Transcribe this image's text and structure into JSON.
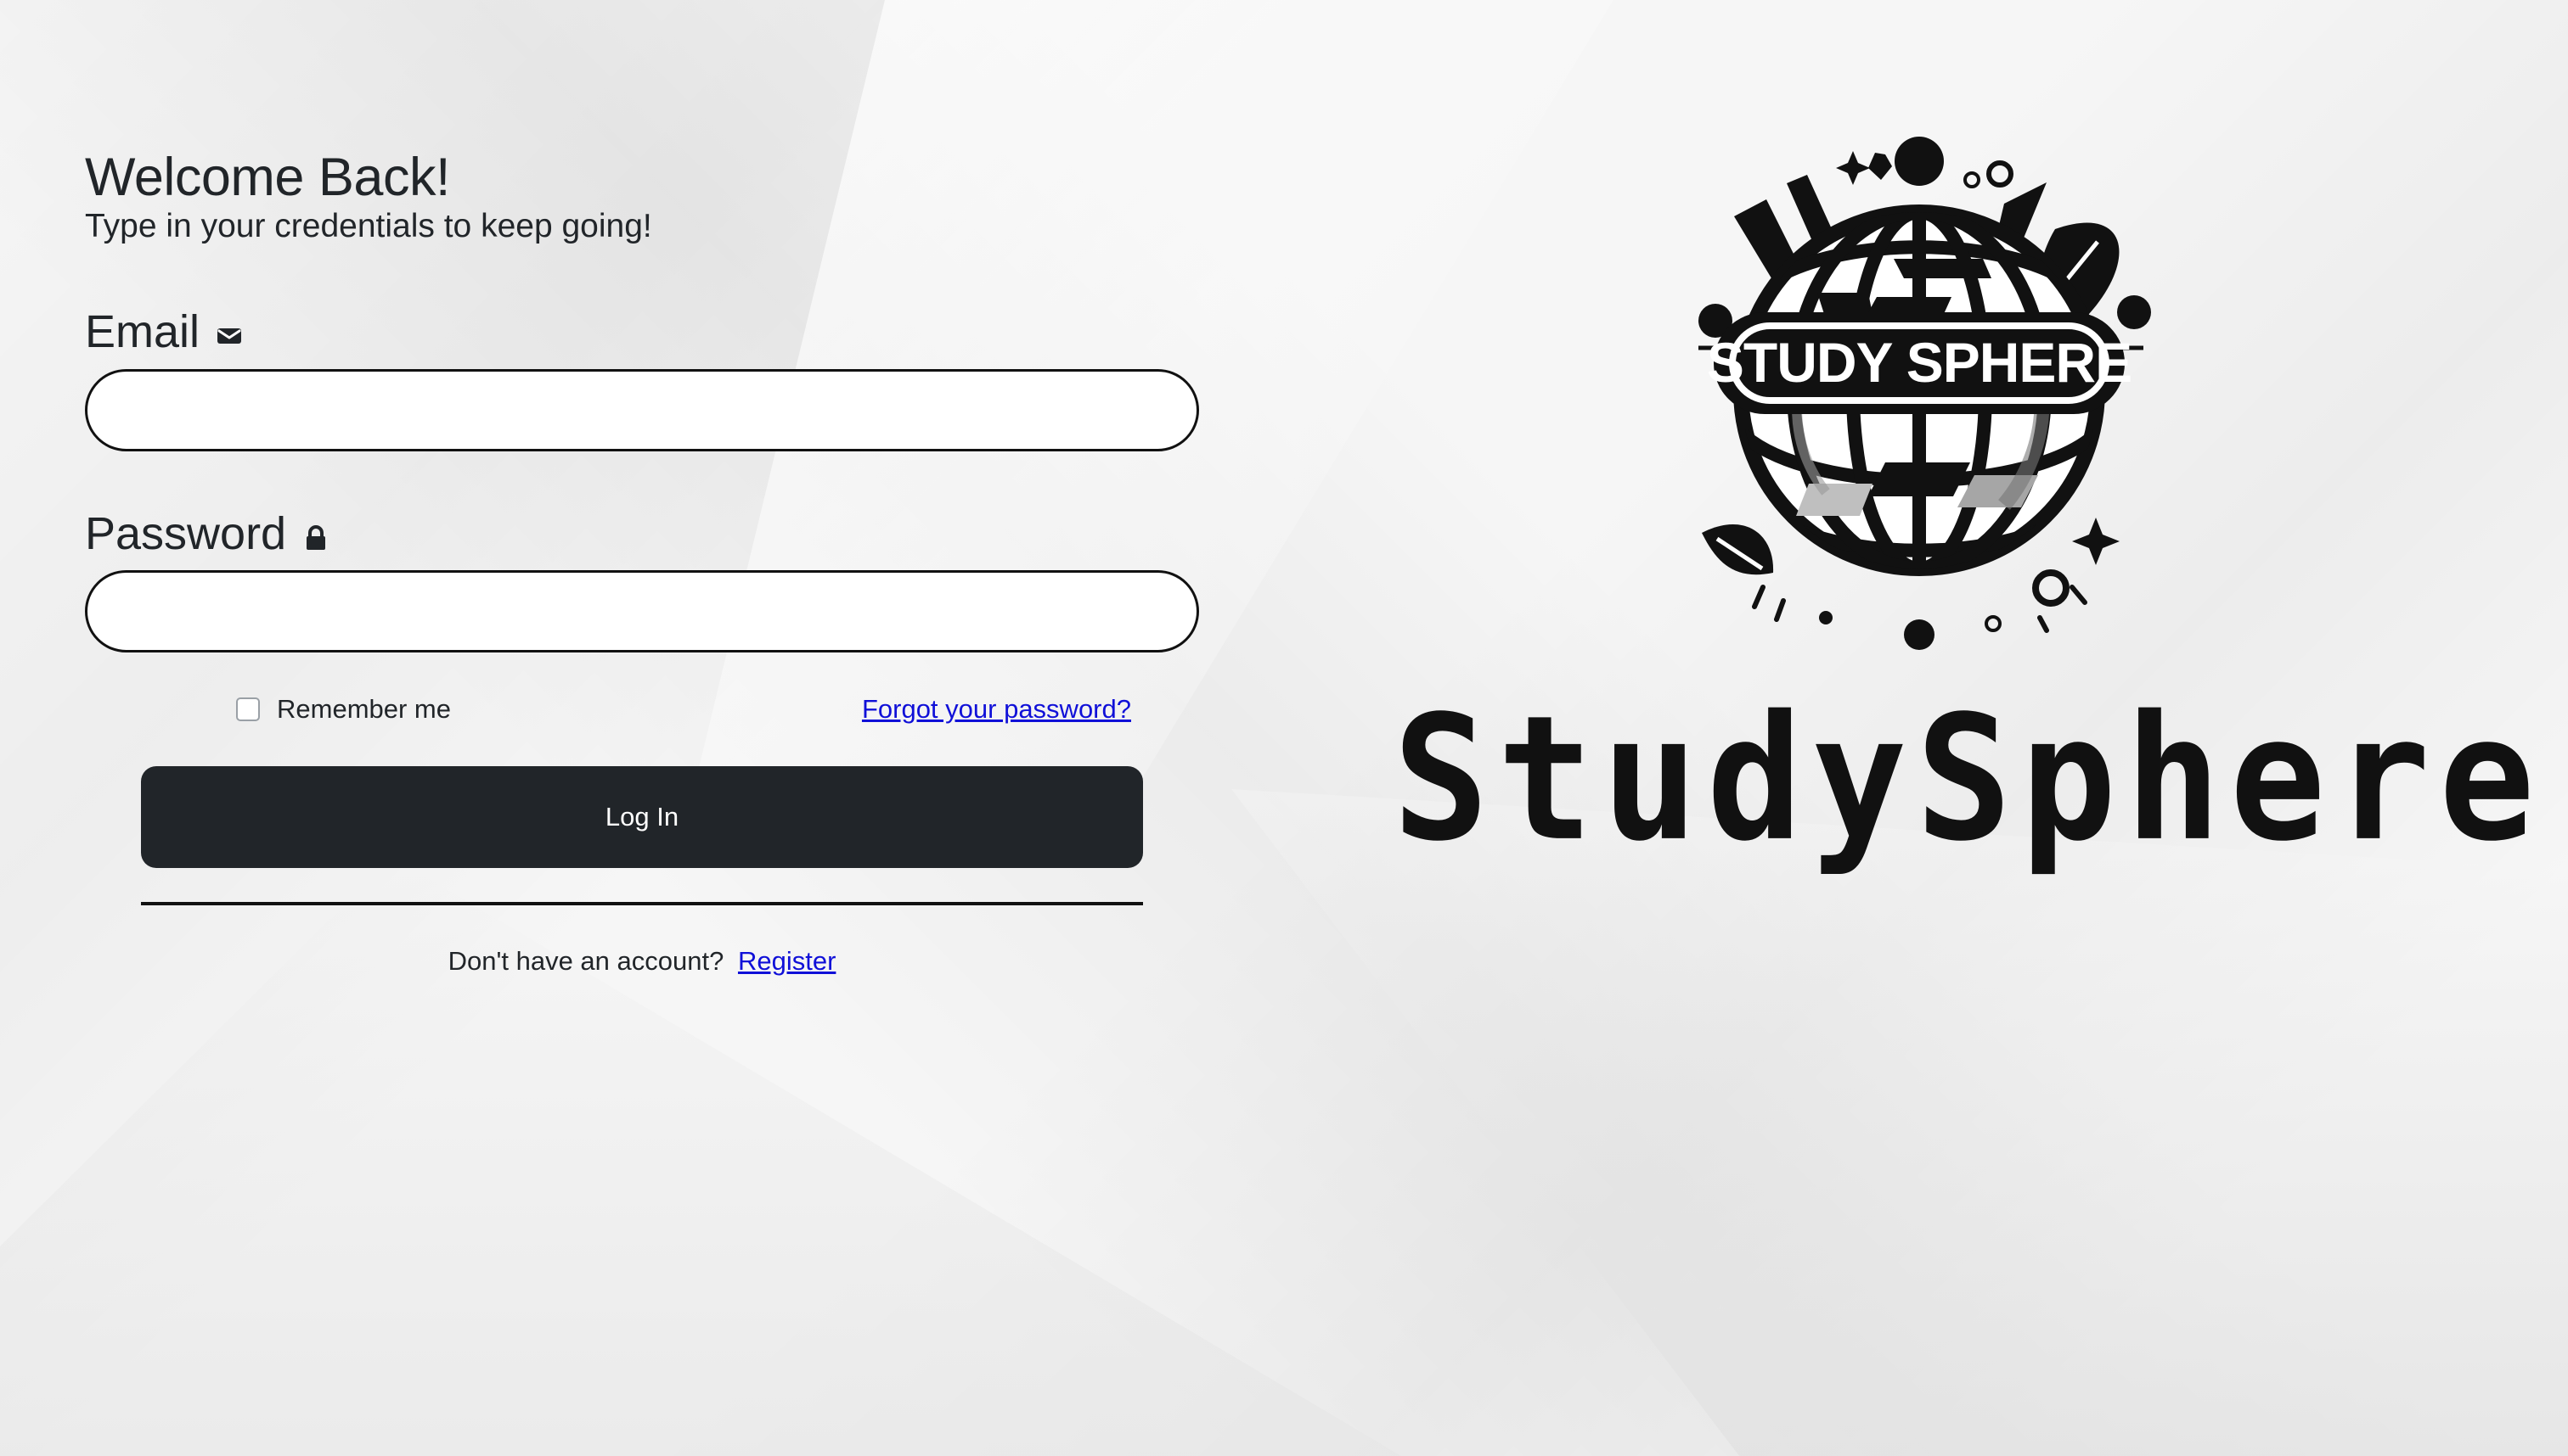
{
  "login": {
    "title": "Welcome Back!",
    "subtitle": "Type in your credentials to keep going!",
    "email_label": "Email",
    "email_icon": "envelope-icon",
    "email_value": "",
    "email_placeholder": "",
    "password_label": "Password",
    "password_icon": "lock-icon",
    "password_value": "",
    "password_placeholder": "",
    "remember_label": "Remember me",
    "remember_checked": false,
    "forgot_link": "Forgot your password?",
    "login_button": "Log In",
    "register_prompt": "Don't have an account?",
    "register_link": "Register"
  },
  "brand": {
    "emblem_text": "STUDY SPHERE",
    "wordmark": "StudySphere"
  },
  "colors": {
    "primary_button": "#212529",
    "link": "#1010D8",
    "border": "#111111"
  }
}
